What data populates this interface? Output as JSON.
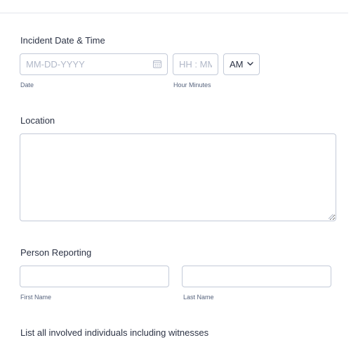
{
  "incident": {
    "label": "Incident Date & Time",
    "date_placeholder": "MM-DD-YYYY",
    "date_sublabel": "Date",
    "time_placeholder": "HH : MM",
    "time_sublabel": "Hour Minutes",
    "ampm_value": "AM"
  },
  "location": {
    "label": "Location",
    "value": ""
  },
  "person_reporting": {
    "label": "Person Reporting",
    "first_name_sublabel": "First Name",
    "last_name_sublabel": "Last Name"
  },
  "involved": {
    "label": "List all involved individuals including witnesses"
  },
  "icons": {
    "calendar": "calendar-icon",
    "dropdown": "chevron-down-icon",
    "resize": "resize-grip-icon"
  }
}
